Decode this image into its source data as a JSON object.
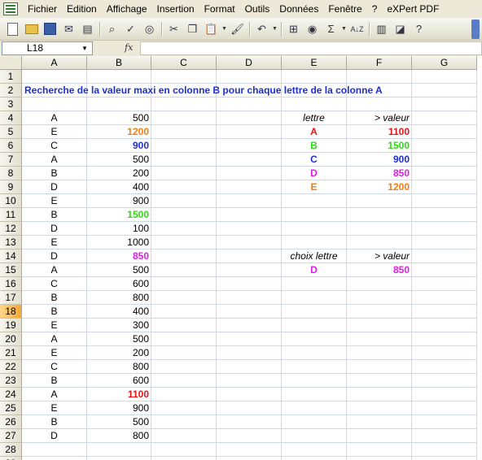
{
  "menubar": {
    "items": [
      "Fichier",
      "Edition",
      "Affichage",
      "Insertion",
      "Format",
      "Outils",
      "Données",
      "Fenêtre",
      "?",
      "eXPert PDF"
    ]
  },
  "toolbar": {
    "sum_symbol": "Σ",
    "sort_label": "A↓Z"
  },
  "formula_bar": {
    "name_box": "L18",
    "fx": "fx",
    "formula": ""
  },
  "grid": {
    "columns": [
      "A",
      "B",
      "C",
      "D",
      "E",
      "F",
      "G"
    ],
    "title": "Recherche de la valeur maxi en colonne B pour chaque lettre de la colonne A",
    "selected_row": 18,
    "rows": [
      {
        "n": "1",
        "a": "",
        "b": "",
        "b_color": "",
        "e": "",
        "e_color": "",
        "f": "",
        "f_color": ""
      },
      {
        "n": "2",
        "a": "",
        "b": "",
        "b_color": "",
        "e": "",
        "e_color": "",
        "f": "",
        "f_color": ""
      },
      {
        "n": "3",
        "a": "",
        "b": "",
        "b_color": "",
        "e": "",
        "e_color": "",
        "f": "",
        "f_color": ""
      },
      {
        "n": "4",
        "a": "A",
        "b": "500",
        "b_color": "",
        "e": "lettre",
        "e_color": "italic",
        "f": "> valeur",
        "f_color": "italic"
      },
      {
        "n": "5",
        "a": "E",
        "b": "1200",
        "b_color": "orange",
        "e": "A",
        "e_color": "red",
        "f": "1100",
        "f_color": "red"
      },
      {
        "n": "6",
        "a": "C",
        "b": "900",
        "b_color": "blue",
        "e": "B",
        "e_color": "green",
        "f": "1500",
        "f_color": "green"
      },
      {
        "n": "7",
        "a": "A",
        "b": "500",
        "b_color": "",
        "e": "C",
        "e_color": "blue",
        "f": "900",
        "f_color": "blue"
      },
      {
        "n": "8",
        "a": "B",
        "b": "200",
        "b_color": "",
        "e": "D",
        "e_color": "magenta",
        "f": "850",
        "f_color": "magenta"
      },
      {
        "n": "9",
        "a": "D",
        "b": "400",
        "b_color": "",
        "e": "E",
        "e_color": "orange",
        "f": "1200",
        "f_color": "orange"
      },
      {
        "n": "10",
        "a": "E",
        "b": "900",
        "b_color": "",
        "e": "",
        "e_color": "",
        "f": "",
        "f_color": ""
      },
      {
        "n": "11",
        "a": "B",
        "b": "1500",
        "b_color": "green",
        "e": "",
        "e_color": "",
        "f": "",
        "f_color": ""
      },
      {
        "n": "12",
        "a": "D",
        "b": "100",
        "b_color": "",
        "e": "",
        "e_color": "",
        "f": "",
        "f_color": ""
      },
      {
        "n": "13",
        "a": "E",
        "b": "1000",
        "b_color": "",
        "e": "",
        "e_color": "",
        "f": "",
        "f_color": ""
      },
      {
        "n": "14",
        "a": "D",
        "b": "850",
        "b_color": "magenta",
        "e": "choix lettre",
        "e_color": "italic",
        "f": "> valeur",
        "f_color": "italic"
      },
      {
        "n": "15",
        "a": "A",
        "b": "500",
        "b_color": "",
        "e": "D",
        "e_color": "magenta",
        "f": "850",
        "f_color": "magenta"
      },
      {
        "n": "16",
        "a": "C",
        "b": "600",
        "b_color": "",
        "e": "",
        "e_color": "",
        "f": "",
        "f_color": ""
      },
      {
        "n": "17",
        "a": "B",
        "b": "800",
        "b_color": "",
        "e": "",
        "e_color": "",
        "f": "",
        "f_color": ""
      },
      {
        "n": "18",
        "a": "B",
        "b": "400",
        "b_color": "",
        "e": "",
        "e_color": "",
        "f": "",
        "f_color": ""
      },
      {
        "n": "19",
        "a": "E",
        "b": "300",
        "b_color": "",
        "e": "",
        "e_color": "",
        "f": "",
        "f_color": ""
      },
      {
        "n": "20",
        "a": "A",
        "b": "500",
        "b_color": "",
        "e": "",
        "e_color": "",
        "f": "",
        "f_color": ""
      },
      {
        "n": "21",
        "a": "E",
        "b": "200",
        "b_color": "",
        "e": "",
        "e_color": "",
        "f": "",
        "f_color": ""
      },
      {
        "n": "22",
        "a": "C",
        "b": "800",
        "b_color": "",
        "e": "",
        "e_color": "",
        "f": "",
        "f_color": ""
      },
      {
        "n": "23",
        "a": "B",
        "b": "600",
        "b_color": "",
        "e": "",
        "e_color": "",
        "f": "",
        "f_color": ""
      },
      {
        "n": "24",
        "a": "A",
        "b": "1100",
        "b_color": "red",
        "e": "",
        "e_color": "",
        "f": "",
        "f_color": ""
      },
      {
        "n": "25",
        "a": "E",
        "b": "900",
        "b_color": "",
        "e": "",
        "e_color": "",
        "f": "",
        "f_color": ""
      },
      {
        "n": "26",
        "a": "B",
        "b": "500",
        "b_color": "",
        "e": "",
        "e_color": "",
        "f": "",
        "f_color": ""
      },
      {
        "n": "27",
        "a": "D",
        "b": "800",
        "b_color": "",
        "e": "",
        "e_color": "",
        "f": "",
        "f_color": ""
      },
      {
        "n": "28",
        "a": "",
        "b": "",
        "b_color": "",
        "e": "",
        "e_color": "",
        "f": "",
        "f_color": ""
      },
      {
        "n": "29",
        "a": "",
        "b": "",
        "b_color": "",
        "e": "",
        "e_color": "",
        "f": "",
        "f_color": ""
      }
    ]
  }
}
